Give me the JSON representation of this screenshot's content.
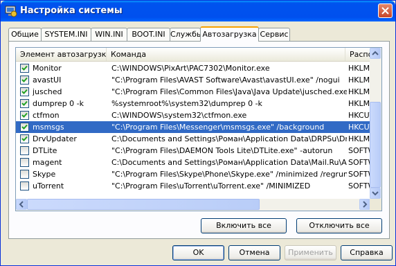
{
  "window": {
    "title": "Настройка системы"
  },
  "tabs": [
    {
      "label": "Общие"
    },
    {
      "label": "SYSTEM.INI"
    },
    {
      "label": "WIN.INI"
    },
    {
      "label": "BOOT.INI"
    },
    {
      "label": "Службы"
    },
    {
      "label": "Автозагрузка",
      "active": true
    },
    {
      "label": "Сервис"
    }
  ],
  "list": {
    "columns": [
      "Элемент автозагрузки",
      "Команда",
      "Распо"
    ],
    "rows": [
      {
        "checked": true,
        "name": "Monitor",
        "command": "C:\\WINDOWS\\PixArt\\PAC7302\\Monitor.exe",
        "location": "HKLM\\S"
      },
      {
        "checked": true,
        "name": "avastUI",
        "command": "\"C:\\Program Files\\AVAST Software\\Avast\\avastUI.exe\" /nogui",
        "location": "HKLM\\S"
      },
      {
        "checked": true,
        "name": "jusched",
        "command": "\"C:\\Program Files\\Common Files\\Java\\Java Update\\jusched.exe\"",
        "location": "HKLM\\S"
      },
      {
        "checked": true,
        "name": "dumprep 0 -k",
        "command": "%systemroot%\\system32\\dumprep 0 -k",
        "location": "HKLM\\S"
      },
      {
        "checked": true,
        "name": "ctfmon",
        "command": "C:\\WINDOWS\\system32\\ctfmon.exe",
        "location": "HKCU\\S"
      },
      {
        "checked": true,
        "name": "msmsgs",
        "command": "\"C:\\Program Files\\Messenger\\msmsgs.exe\" /background",
        "location": "HKCU\\S",
        "selected": true
      },
      {
        "checked": true,
        "name": "DrvUpdater",
        "command": "C:\\Documents and Settings\\Роман\\Application Data\\DRPSu\\DrvUp...",
        "location": "HKLM\\S"
      },
      {
        "checked": false,
        "name": "DTLite",
        "command": "\"C:\\Program Files\\DAEMON Tools Lite\\DTLite.exe\" -autorun",
        "location": "SOFTW"
      },
      {
        "checked": false,
        "name": "magent",
        "command": "C:\\Documents and Settings\\Роман\\Application Data\\Mail.Ru\\Agen...",
        "location": "SOFTW"
      },
      {
        "checked": false,
        "name": "Skype",
        "command": "\"C:\\Program Files\\Skype\\Phone\\Skype.exe\" /minimized /regrun",
        "location": "SOFTW"
      },
      {
        "checked": false,
        "name": "uTorrent",
        "command": "\"C:\\Program Files\\uTorrent\\uTorrent.exe\"  /MINIMIZED",
        "location": "SOFTW"
      }
    ]
  },
  "buttons": {
    "enable_all": "Включить все",
    "disable_all": "Отключить все",
    "ok": "OK",
    "cancel": "Отмена",
    "apply": "Применить",
    "help": "Справка"
  },
  "icons": {
    "title": "settings-monitor-icon",
    "close": "close-icon",
    "checkbox": "checkmark-icon"
  },
  "colors": {
    "titlebar": "#0053ee",
    "selection": "#316ac5",
    "active_tab_accent": "#f7a100"
  }
}
